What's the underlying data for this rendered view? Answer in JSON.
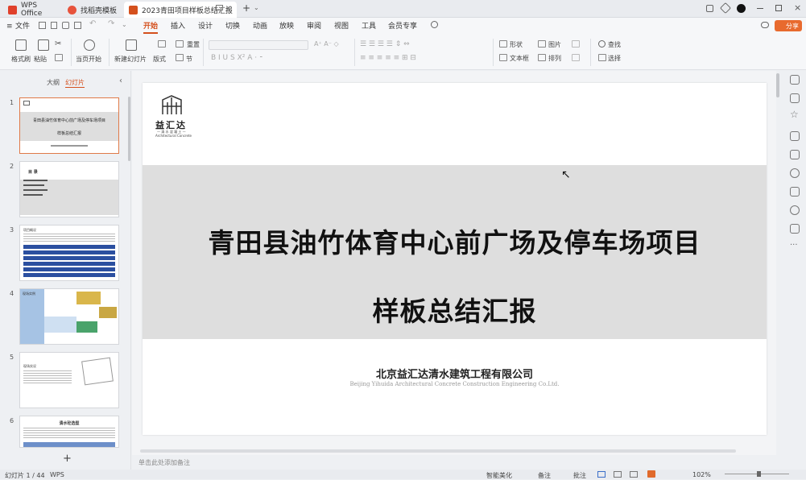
{
  "tabs": [
    {
      "label": "WPS Office"
    },
    {
      "label": "找稻壳模板"
    },
    {
      "label": "2023青田项目样板总结汇报"
    }
  ],
  "menu": {
    "file": "文件",
    "items": [
      "开始",
      "插入",
      "设计",
      "切换",
      "动画",
      "放映",
      "审阅",
      "视图",
      "工具",
      "会员专享"
    ],
    "share": "分享"
  },
  "ribbon": {
    "format_painter": "格式刷",
    "paste": "粘贴",
    "from_start": "当页开始",
    "new_slide": "新建幻灯片",
    "layout": "版式",
    "section": "节",
    "reset": "重置",
    "shapes": "形状",
    "picture": "图片",
    "textbox": "文本框",
    "arrange": "排列",
    "find": "查找",
    "select": "选择"
  },
  "left_panel": {
    "outline": "大纲",
    "slides": "幻灯片",
    "numbers": [
      "1",
      "2",
      "3",
      "4",
      "5",
      "6"
    ],
    "thumb1_title": "青田县油竹体育中心前广场及停车场项目",
    "thumb1_sub": "样板总结汇报",
    "thumb2_title": "目 录",
    "thumb3_title": "项目概况",
    "thumb4_title": "现场实例",
    "thumb5_title": "现场实况",
    "thumb6_title": "清水砼选型",
    "add": "+"
  },
  "slide": {
    "logo_text": "益汇达",
    "logo_sub": "— 清 水 混 凝 土 —",
    "logo_en": "Architectural Concrete",
    "title_line1": "青田县油竹体育中心前广场及停车场项目",
    "title_line2": "样板总结汇报",
    "company": "北京益汇达清水建筑工程有限公司",
    "company_en": "Beijing Yihuida Architectural Concrete Construction Engineering Co.Ltd."
  },
  "note": {
    "placeholder": "单击此处添加备注"
  },
  "status": {
    "slide_count": "幻灯片 1 / 44",
    "app": "WPS",
    "beautify": "智能美化",
    "notes": "备注",
    "comments": "批注",
    "zoom": "102%"
  },
  "colors": {
    "accent": "#d4501d",
    "band": "#dedede"
  }
}
